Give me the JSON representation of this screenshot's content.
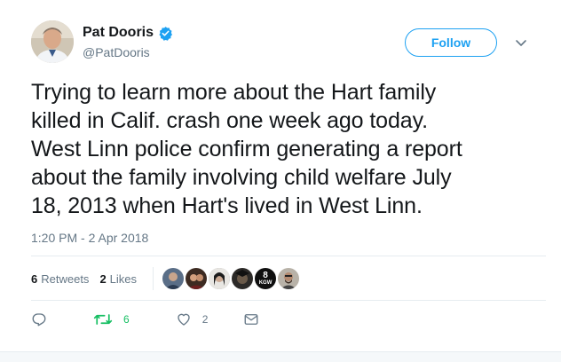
{
  "author": {
    "name": "Pat Dooris",
    "handle": "@PatDooris",
    "verified": true
  },
  "header": {
    "follow_label": "Follow"
  },
  "tweet": {
    "lines": [
      "Trying to learn more about the Hart family",
      "killed in Calif. crash one week ago today.",
      "West Linn police confirm generating a report",
      "about the family involving child welfare July",
      "18, 2013 when Hart's lived in West Linn."
    ],
    "timestamp": "1:20 PM - 2 Apr 2018"
  },
  "stats": {
    "retweets_count": "6",
    "retweets_label": "Retweets",
    "likes_count": "2",
    "likes_label": "Likes",
    "liker_badge_number": "8",
    "liker_badge_text": "KGW"
  },
  "actions": {
    "retweet_count": "6",
    "like_count": "2"
  },
  "colors": {
    "accent": "#1da1f2",
    "retweet": "#17bf63",
    "muted": "#657786",
    "text": "#14171a"
  },
  "icons": [
    "verified-badge-icon",
    "chevron-down-icon",
    "reply-icon",
    "retweet-icon",
    "heart-icon",
    "message-icon"
  ]
}
